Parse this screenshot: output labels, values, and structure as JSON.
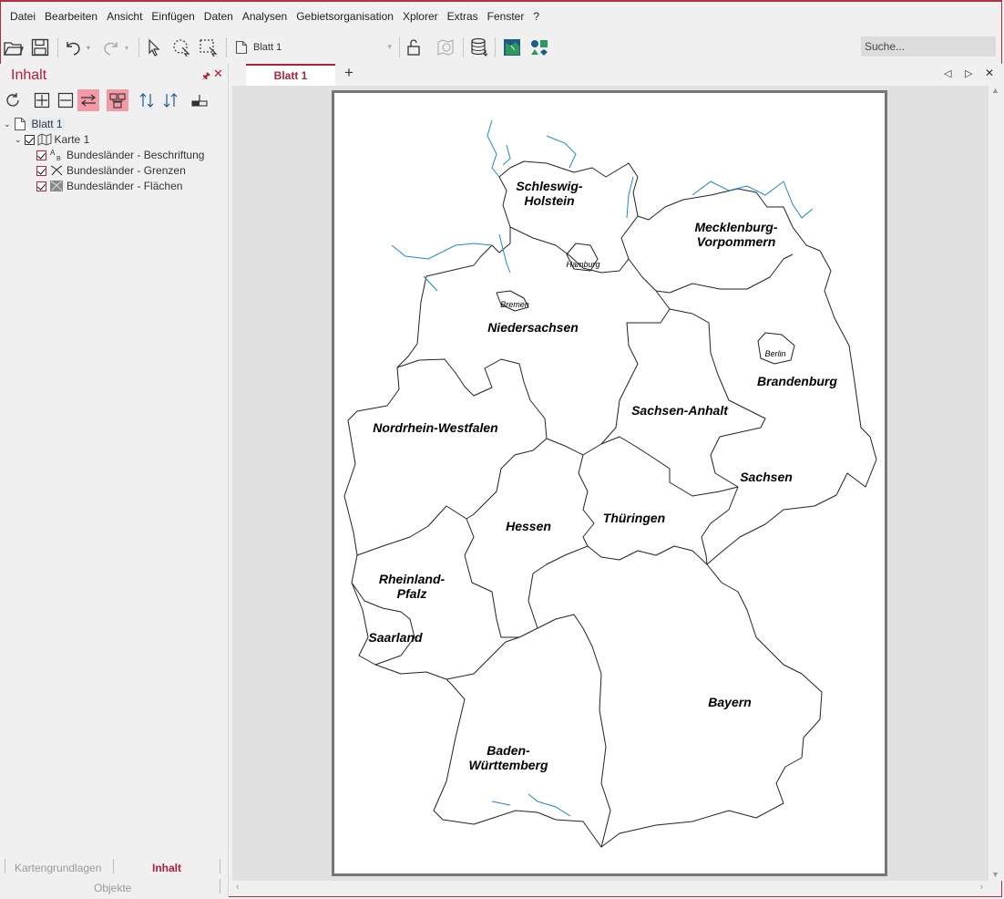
{
  "menu": [
    "Datei",
    "Bearbeiten",
    "Ansicht",
    "Einfügen",
    "Daten",
    "Analysen",
    "Gebietsorganisation",
    "Xplorer",
    "Extras",
    "Fenster",
    "?"
  ],
  "toolbar": {
    "document_select": "Blatt 1",
    "search_placeholder": "Suche..."
  },
  "panel": {
    "title": "Inhalt",
    "tree": {
      "sheet": "Blatt 1",
      "map": "Karte 1",
      "layers": [
        "Bundesländer - Beschriftung",
        "Bundesländer - Grenzen",
        "Bundesländer - Flächen"
      ]
    },
    "bottom_tabs": {
      "tab1": "Kartengrundlagen",
      "tab2": "Inhalt",
      "tab3": "Objekte"
    }
  },
  "doc_tab": {
    "label": "Blatt 1",
    "add": "+"
  },
  "map": {
    "states": {
      "sh1": "Schleswig-",
      "sh2": "Holstein",
      "mv1": "Mecklenburg-",
      "mv2": "Vorpommern",
      "hh": "Hamburg",
      "hb": "Bremen",
      "ni": "Niedersachsen",
      "be": "Berlin",
      "bb": "Brandenburg",
      "st": "Sachsen-Anhalt",
      "nw": "Nordrhein-Westfalen",
      "sn": "Sachsen",
      "he": "Hessen",
      "th": "Thüringen",
      "rp1": "Rheinland-",
      "rp2": "Pfalz",
      "sl": "Saarland",
      "by": "Bayern",
      "bw1": "Baden-",
      "bw2": "Württemberg"
    }
  },
  "colors": {
    "accent": "#b0203a",
    "water": "#1a8ad0"
  }
}
